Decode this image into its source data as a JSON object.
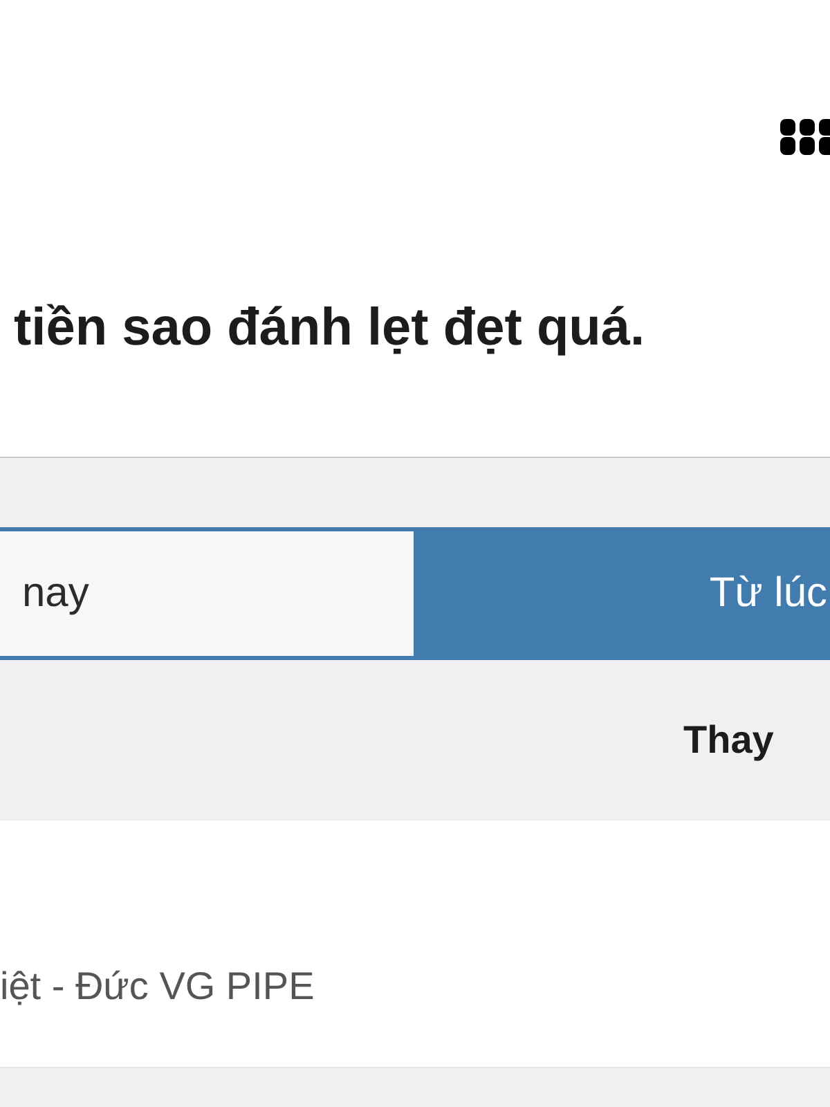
{
  "headline": "tiền sao đánh lẹt đẹt quá.",
  "tabs": [
    {
      "label": "nay",
      "selected": false
    },
    {
      "label": "Từ lúc",
      "selected": true
    }
  ],
  "table": {
    "column_header": "Thay"
  },
  "rows": [
    {
      "name": "iệt - Đức VG PIPE"
    }
  ]
}
